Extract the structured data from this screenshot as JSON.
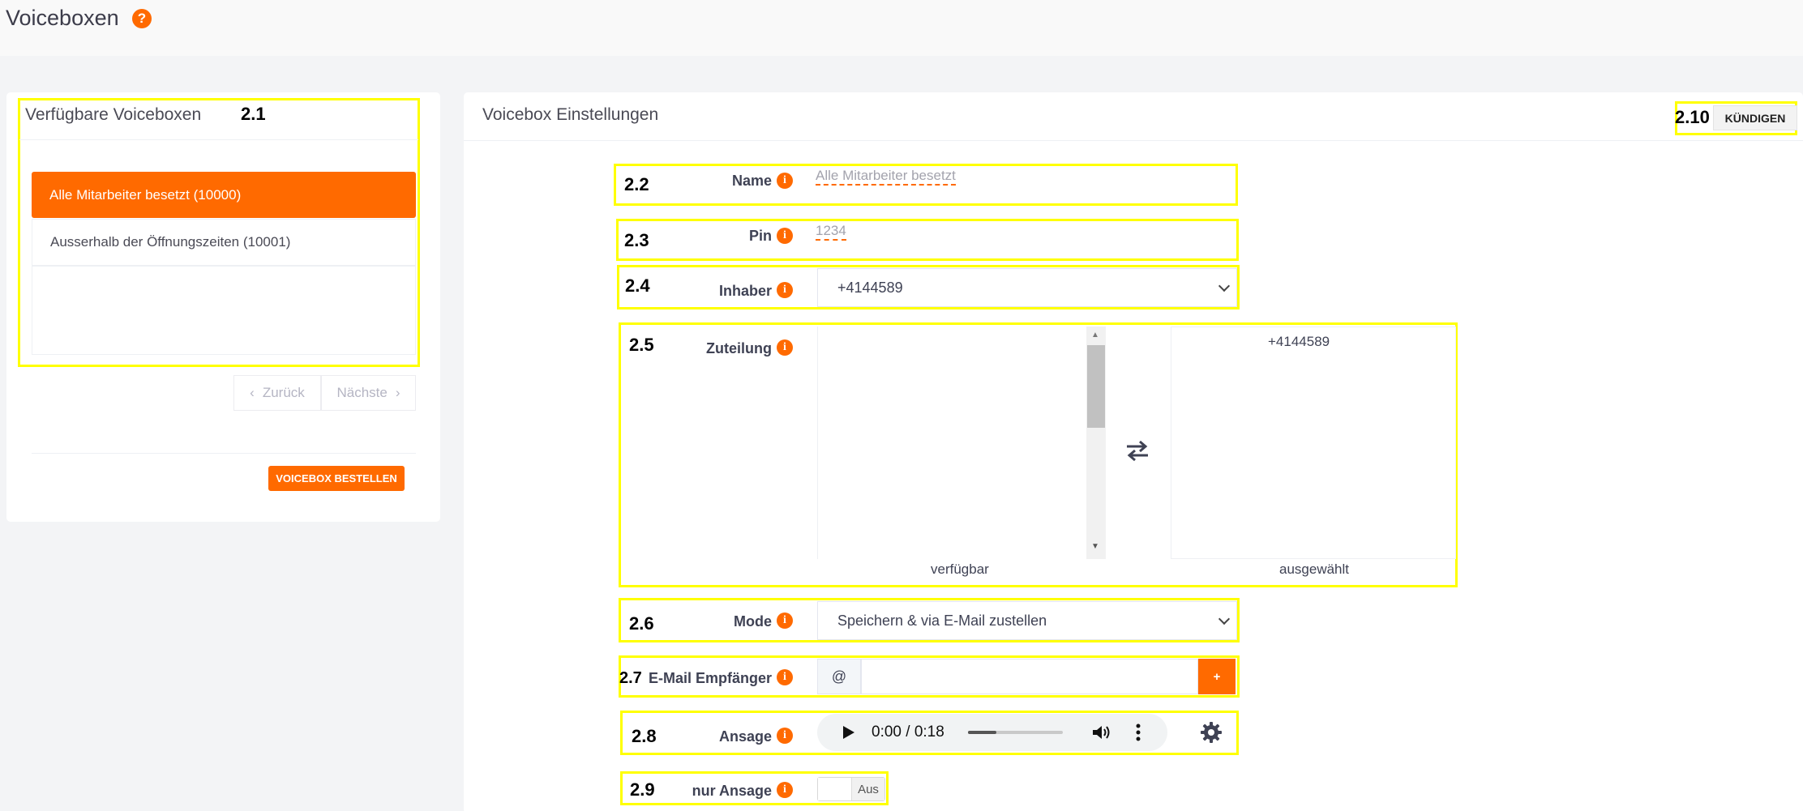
{
  "page": {
    "title": "Voiceboxen"
  },
  "left_panel": {
    "title": "Verfügbare Voiceboxen",
    "items": [
      {
        "label": "Alle Mitarbeiter besetzt (10000)",
        "active": true
      },
      {
        "label": "Ausserhalb der Öffnungszeiten (10001)",
        "active": false
      }
    ],
    "pagination": {
      "prev": "Zurück",
      "next": "Nächste"
    },
    "order_button": "VOICEBOX BESTELLEN"
  },
  "right_panel": {
    "title": "Voicebox Einstellungen",
    "cancel_button": "KÜNDIGEN"
  },
  "form": {
    "name": {
      "label": "Name",
      "value": "Alle Mitarbeiter besetzt"
    },
    "pin": {
      "label": "Pin",
      "value": "1234"
    },
    "owner": {
      "label": "Inhaber",
      "value": "+4144589"
    },
    "allocation": {
      "label": "Zuteilung",
      "available_label": "verfügbar",
      "selected_label": "ausgewählt",
      "selected_items": [
        "+4144589"
      ]
    },
    "mode": {
      "label": "Mode",
      "value": "Speichern & via E-Mail zustellen"
    },
    "email": {
      "label": "E-Mail Empfänger",
      "prefix": "@",
      "value": "",
      "add": "+"
    },
    "announcement": {
      "label": "Ansage",
      "time": "0:00 / 0:18",
      "progress": 0.3
    },
    "only_announcement": {
      "label": "nur Ansage",
      "state": "Aus"
    }
  },
  "annotations": {
    "a2_1": "2.1",
    "a2_2": "2.2",
    "a2_3": "2.3",
    "a2_4": "2.4",
    "a2_5": "2.5",
    "a2_6": "2.6",
    "a2_7": "2.7",
    "a2_8": "2.8",
    "a2_9": "2.9",
    "a2_10": "2.10"
  },
  "icons": {
    "help": "question-circle-icon",
    "info": "info-circle-icon",
    "prev": "chevron-left-icon",
    "next": "chevron-right-icon",
    "swap": "swap-arrows-icon",
    "play": "play-icon",
    "volume": "volume-icon",
    "more": "more-vertical-icon",
    "settings": "gear-icon"
  },
  "colors": {
    "accent": "#ff6a00",
    "highlight": "#ffff00"
  }
}
